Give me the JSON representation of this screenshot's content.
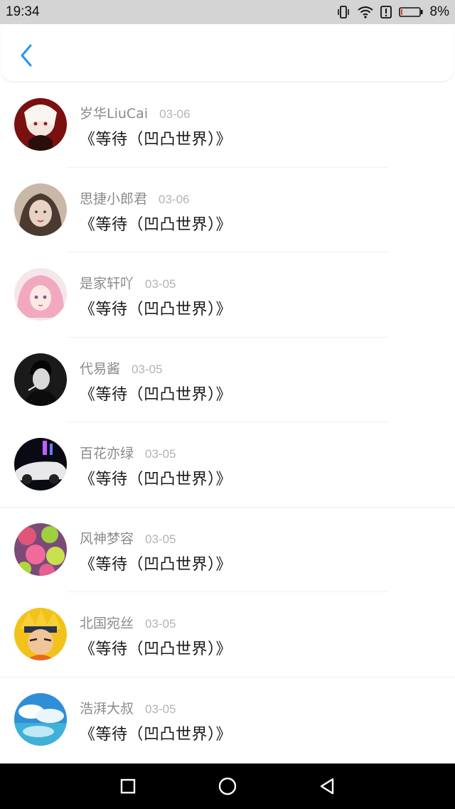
{
  "status_bar": {
    "time": "19:34",
    "battery_percent": "8%",
    "battery_level": 0.08,
    "battery_color": "#e53935",
    "icons": [
      "vibrate-icon",
      "wifi-icon",
      "alert-icon",
      "battery-icon"
    ]
  },
  "header": {
    "back_icon": "chevron-left-icon",
    "accent_color": "#2196f3"
  },
  "list": {
    "items": [
      {
        "username": "岁华LiuCai",
        "date": "03-06",
        "song": "《等待（凹凸世界）》"
      },
      {
        "username": "思捷小郎君",
        "date": "03-06",
        "song": "《等待（凹凸世界）》"
      },
      {
        "username": "是家轩吖",
        "date": "03-05",
        "song": "《等待（凹凸世界）》"
      },
      {
        "username": "代易酱",
        "date": "03-05",
        "song": "《等待（凹凸世界）》"
      },
      {
        "username": "百花亦绿",
        "date": "03-05",
        "song": "《等待（凹凸世界）》"
      },
      {
        "username": "风神梦容",
        "date": "03-05",
        "song": "《等待（凹凸世界）》"
      },
      {
        "username": "北国宛丝",
        "date": "03-05",
        "song": "《等待（凹凸世界）》"
      },
      {
        "username": "浩湃大叔",
        "date": "03-05",
        "song": "《等待（凹凸世界）》"
      }
    ]
  },
  "nav_bar": {
    "icons": [
      "recents-square-icon",
      "home-circle-icon",
      "back-triangle-icon"
    ]
  }
}
